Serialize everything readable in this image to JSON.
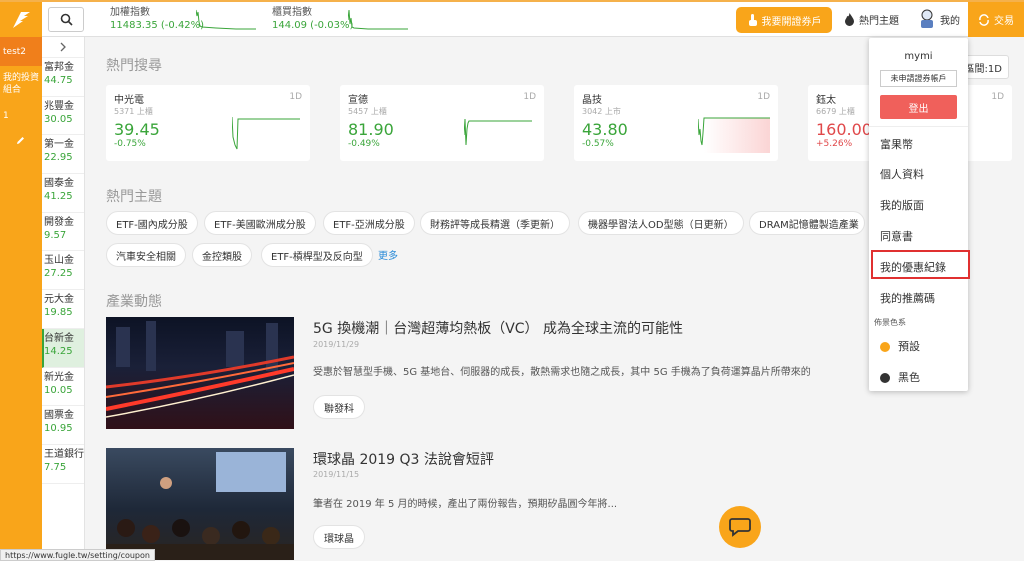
{
  "topbar": {
    "index1": {
      "name": "加權指數",
      "value": "11483.35 (-0.42%)"
    },
    "index2": {
      "name": "櫃買指數",
      "value": "144.09 (-0.03%)"
    },
    "open_account": "我要開證券戶",
    "hot_topics": "熱門主題",
    "mine": "我的",
    "trade": "交易"
  },
  "sidebar": {
    "items": [
      "test2",
      "我的投資組合",
      "1"
    ],
    "icons": [
      "logo-icon",
      "pencil-icon"
    ]
  },
  "stocks": [
    {
      "name": "富邦金",
      "price": "44.75"
    },
    {
      "name": "兆豐金",
      "price": "30.05"
    },
    {
      "name": "第一金",
      "price": "22.95"
    },
    {
      "name": "國泰金",
      "price": "41.25"
    },
    {
      "name": "開發金",
      "price": "9.57"
    },
    {
      "name": "玉山金",
      "price": "27.25"
    },
    {
      "name": "元大金",
      "price": "19.85"
    },
    {
      "name": "台新金",
      "price": "14.25"
    },
    {
      "name": "新光金",
      "price": "10.05"
    },
    {
      "name": "國票金",
      "price": "10.95"
    },
    {
      "name": "王道銀行",
      "price": "7.75"
    }
  ],
  "hot_search": {
    "title": "熱門搜尋",
    "period_label": "區間:1D",
    "cards": [
      {
        "name": "中光電",
        "sub": "5371 上櫃",
        "price": "39.45",
        "change": "-0.75%",
        "period": "1D"
      },
      {
        "name": "宣德",
        "sub": "5457 上櫃",
        "price": "81.90",
        "change": "-0.49%",
        "period": "1D"
      },
      {
        "name": "晶技",
        "sub": "3042 上市",
        "price": "43.80",
        "change": "-0.57%",
        "period": "1D"
      },
      {
        "name": "鈺太",
        "sub": "6679 上櫃",
        "price": "160.00",
        "change": "+5.26%",
        "period": "1D"
      }
    ]
  },
  "hot_topics": {
    "title": "熱門主題",
    "chips": [
      "ETF-國內成分股",
      "ETF-美國歐洲成分股",
      "ETF-亞洲成分股",
      "財務評等成長精選（季更新）",
      "機器學習法人OD型態（日更新）",
      "DRAM記憶體製造產業",
      "汽車安全相關",
      "金控類股",
      "ETF-槓桿型及反向型"
    ],
    "more": "更多"
  },
  "industry": {
    "title": "產業動態",
    "articles": [
      {
        "title": "5G 換機潮｜台灣超薄均熱板（VC） 成為全球主流的可能性",
        "date": "2019/11/29",
        "desc": "受惠於智慧型手機、5G 基地台、伺服器的成長，散熱需求也隨之成長，其中 5G 手機為了負荷運算晶片所帶來的",
        "tag": "聯發科"
      },
      {
        "title": "環球晶 2019 Q3 法說會短評",
        "date": "2019/11/15",
        "desc": "筆者在 2019 年 5 月的時候，產出了兩份報告，預期矽晶圓今年將...",
        "tag": "環球晶"
      }
    ]
  },
  "dropdown": {
    "username": "mymi",
    "account_status": "未申請證券帳戶",
    "logout": "登出",
    "items": [
      "富果幣",
      "個人資料",
      "我的版面",
      "同意書",
      "我的優惠紀錄",
      "我的推薦碼"
    ],
    "theme_label": "佈景色系",
    "themes": [
      {
        "name": "預設",
        "color": "#f9a51a"
      },
      {
        "name": "黑色",
        "color": "#333333"
      }
    ]
  },
  "status_url": "https://www.fugle.tw/setting/coupon",
  "colors": {
    "brand": "#f9a51a",
    "up": "#e0484a",
    "down": "#3aa53a",
    "highlight": "#e03030"
  }
}
